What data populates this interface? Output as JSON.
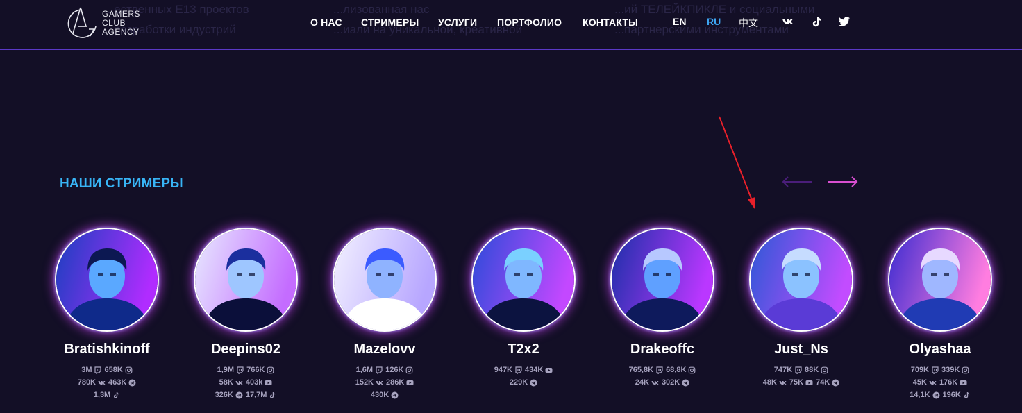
{
  "header": {
    "logo_lines": [
      "GAMERS",
      "CLUB",
      "AGENCY"
    ],
    "nav": [
      "О НАС",
      "СТРИМЕРЫ",
      "УСЛУГИ",
      "ПОРТФОЛИО",
      "КОНТАКТЫ"
    ],
    "languages": [
      "EN",
      "RU",
      "中文"
    ],
    "active_language": "RU",
    "socials": [
      "vk-icon",
      "tiktok-icon",
      "twitter-icon"
    ],
    "background_text": [
      "...ественных E13 проектов",
      "...разработки индустрий",
      "...лизованная нас",
      "...иали на уникальной, креативной",
      "...ий ТЕЛЕЙКПИКЛЕ и социальными",
      "...партнерскими инструментами"
    ]
  },
  "section": {
    "title": "НАШИ СТРИМЕРЫ",
    "prev_arrow": "arrow-left-icon",
    "next_arrow": "arrow-right-icon"
  },
  "colors": {
    "background": "#130f26",
    "accent_blue": "#38b4f5",
    "accent_pink": "#d94fd1",
    "nav_divider": "#5b39c7",
    "annotation": "#e8202a"
  },
  "streamers": [
    {
      "name": "Bratishkinoff",
      "rows": [
        [
          {
            "value": "3M",
            "icon": "twitch-icon"
          },
          {
            "value": "658K",
            "icon": "instagram-icon"
          }
        ],
        [
          {
            "value": "780K",
            "icon": "vk-icon"
          },
          {
            "value": "463K",
            "icon": "telegram-icon"
          }
        ],
        [
          {
            "value": "1,3M",
            "icon": "tiktok-icon"
          }
        ]
      ]
    },
    {
      "name": "Deepins02",
      "rows": [
        [
          {
            "value": "1,9M",
            "icon": "twitch-icon"
          },
          {
            "value": "766K",
            "icon": "instagram-icon"
          }
        ],
        [
          {
            "value": "58K",
            "icon": "vk-icon"
          },
          {
            "value": "403k",
            "icon": "youtube-icon"
          }
        ],
        [
          {
            "value": "326K",
            "icon": "telegram-icon"
          },
          {
            "value": "17,7M",
            "icon": "tiktok-icon"
          }
        ]
      ]
    },
    {
      "name": "Mazelovv",
      "rows": [
        [
          {
            "value": "1,6M",
            "icon": "twitch-icon"
          },
          {
            "value": "126K",
            "icon": "instagram-icon"
          }
        ],
        [
          {
            "value": "152K",
            "icon": "vk-icon"
          },
          {
            "value": "286K",
            "icon": "youtube-icon"
          }
        ],
        [
          {
            "value": "430K",
            "icon": "telegram-icon"
          }
        ]
      ]
    },
    {
      "name": "T2x2",
      "rows": [
        [
          {
            "value": "947K",
            "icon": "twitch-icon"
          },
          {
            "value": "434K",
            "icon": "youtube-icon"
          }
        ],
        [
          {
            "value": "229K",
            "icon": "telegram-icon"
          }
        ]
      ]
    },
    {
      "name": "Drakeoffc",
      "rows": [
        [
          {
            "value": "765,8K",
            "icon": "twitch-icon"
          },
          {
            "value": "68,8K",
            "icon": "instagram-icon"
          }
        ],
        [
          {
            "value": "24K",
            "icon": "vk-icon"
          },
          {
            "value": "302K",
            "icon": "telegram-icon"
          }
        ]
      ]
    },
    {
      "name": "Just_Ns",
      "rows": [
        [
          {
            "value": "747K",
            "icon": "twitch-icon"
          },
          {
            "value": "88K",
            "icon": "instagram-icon"
          }
        ],
        [
          {
            "value": "48K",
            "icon": "vk-icon"
          },
          {
            "value": "75K",
            "icon": "youtube-icon"
          },
          {
            "value": "74K",
            "icon": "telegram-icon"
          }
        ]
      ]
    },
    {
      "name": "Olyashaa",
      "rows": [
        [
          {
            "value": "709K",
            "icon": "twitch-icon"
          },
          {
            "value": "339K",
            "icon": "instagram-icon"
          }
        ],
        [
          {
            "value": "45K",
            "icon": "vk-icon"
          },
          {
            "value": "176K",
            "icon": "youtube-icon"
          }
        ],
        [
          {
            "value": "14,1K",
            "icon": "telegram-icon"
          },
          {
            "value": "196K",
            "icon": "tiktok-icon"
          }
        ]
      ]
    }
  ]
}
